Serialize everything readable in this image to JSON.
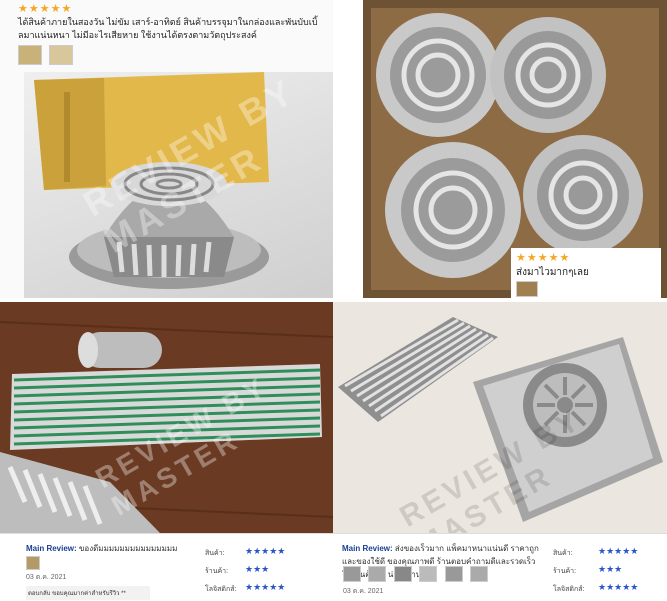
{
  "panel_tl": {
    "stars": "★★★★★",
    "review": "ได้สินค้าภายในสองวัน ไม่ขัม เสาร์-อาทิตย์ สินค้าบรรจุมาในกล่องและพันบับเบิ้ลมาแน่นหนา ไม่มีอะไรเสียหาย ใช้งานได้ตรงตามวัตถุประสงค์"
  },
  "panel_tr": {
    "stars": "★★★★★",
    "review": "ส่งมาไวมากๆเลย"
  },
  "watermark": "REVIEW BY MASTER",
  "review_left": {
    "main_label": "Main Review:",
    "main_text": "ของดีมมมมมมมมมมมมมมม",
    "date": "03 ต.ค. 2021",
    "reply": "ตอบกลับ ขอบคุณมากค่าสำหรับรีวิว **",
    "metrics": [
      {
        "label": "สินค้า:",
        "stars": "★★★★★"
      },
      {
        "label": "ร้านค้า:",
        "stars": "★★★"
      },
      {
        "label": "โลจิสติกส์:",
        "stars": "★★★★★"
      }
    ]
  },
  "review_right": {
    "main_label": "Main Review:",
    "main_text": "ส่งของเร็วมาก แพ็คมาหนาแน่นดี ราคาถูกและของใช้ดี ของคุณภาพดี ร้านตอบคำถามดีและรวดเร็ว ใช้งานคุ้มค่า น่าใช้งานได้ดี",
    "date": "03 ต.ค. 2021",
    "metrics": [
      {
        "label": "สินค้า:",
        "stars": "★★★★★"
      },
      {
        "label": "ร้านค้า:",
        "stars": "★★★"
      },
      {
        "label": "โลจิสติกส์:",
        "stars": "★★★★★"
      }
    ]
  }
}
